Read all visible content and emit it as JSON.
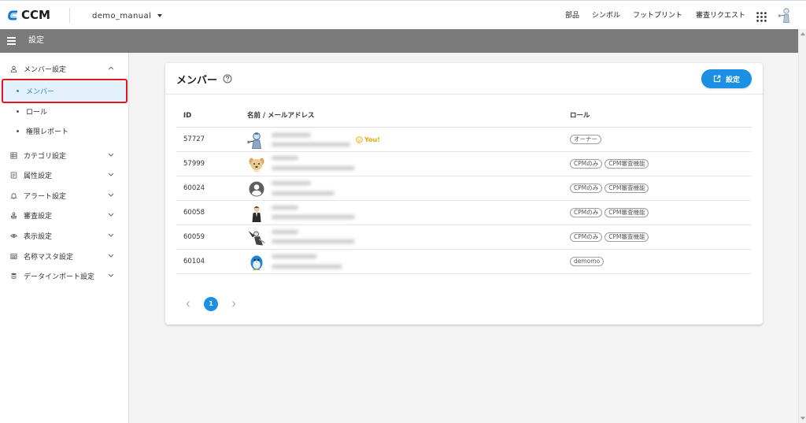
{
  "app": {
    "logo_text": "CCM",
    "logo_icon": "ccm-logo-icon",
    "project_name": "demo_manual"
  },
  "header": {
    "nav": [
      {
        "label": "部品"
      },
      {
        "label": "シンボル"
      },
      {
        "label": "フットプリント"
      },
      {
        "label": "審査リクエスト"
      }
    ],
    "apps_icon": "apps-grid-icon",
    "user_icon": "user-avatar-icon"
  },
  "subbar": {
    "title": "設定",
    "menu_icon": "hamburger-menu-icon"
  },
  "sidebar": {
    "groups": [
      {
        "label": "メンバー設定",
        "icon": "person-icon",
        "expanded": true,
        "children": [
          {
            "label": "メンバー",
            "selected": true
          },
          {
            "label": "ロール",
            "selected": false
          },
          {
            "label": "権限レポート",
            "selected": false
          }
        ]
      },
      {
        "label": "カテゴリ設定",
        "icon": "category-list-icon",
        "expanded": false
      },
      {
        "label": "属性設定",
        "icon": "attribute-document-icon",
        "expanded": false
      },
      {
        "label": "アラート設定",
        "icon": "bell-icon",
        "expanded": false
      },
      {
        "label": "審査設定",
        "icon": "stamp-icon",
        "expanded": false
      },
      {
        "label": "表示設定",
        "icon": "eye-icon",
        "expanded": false
      },
      {
        "label": "名称マスタ設定",
        "icon": "table-icon",
        "expanded": false
      },
      {
        "label": "データインポート設定",
        "icon": "database-icon",
        "expanded": false
      }
    ]
  },
  "members_card": {
    "title": "メンバー",
    "help_icon": "help-circle-icon",
    "settings_button": {
      "label": "設定",
      "icon": "edit-square-icon"
    },
    "columns": {
      "id": "ID",
      "name": "名前 / メールアドレス",
      "role": "ロール"
    },
    "you_label": "You!",
    "rows": [
      {
        "id": "57727",
        "avatar": "robot-avatar",
        "is_you": true,
        "roles": [
          "オーナー"
        ]
      },
      {
        "id": "57999",
        "avatar": "dog-avatar",
        "is_you": false,
        "roles": [
          "CPMのみ",
          "CPM審査機能"
        ]
      },
      {
        "id": "60024",
        "avatar": "default-account-avatar",
        "is_you": false,
        "roles": [
          "CPMのみ",
          "CPM審査機能"
        ]
      },
      {
        "id": "60058",
        "avatar": "businessman-avatar",
        "is_you": false,
        "roles": [
          "CPMのみ",
          "CPM審査機能"
        ]
      },
      {
        "id": "60059",
        "avatar": "mechanic-avatar",
        "is_you": false,
        "roles": [
          "CPMのみ",
          "CPM審査機能"
        ]
      },
      {
        "id": "60104",
        "avatar": "blue-bird-avatar",
        "is_you": false,
        "roles": [
          "demomo"
        ]
      }
    ],
    "pagination": {
      "current_page": "1",
      "prev_icon": "chevron-left-icon",
      "next_icon": "chevron-right-icon"
    }
  },
  "colors": {
    "accent": "#1a8fe3",
    "subbar": "#7a7a7a",
    "selected_bg": "#e3f1fc",
    "you_badge": "#e6a700",
    "annotation": "#e8141b"
  }
}
